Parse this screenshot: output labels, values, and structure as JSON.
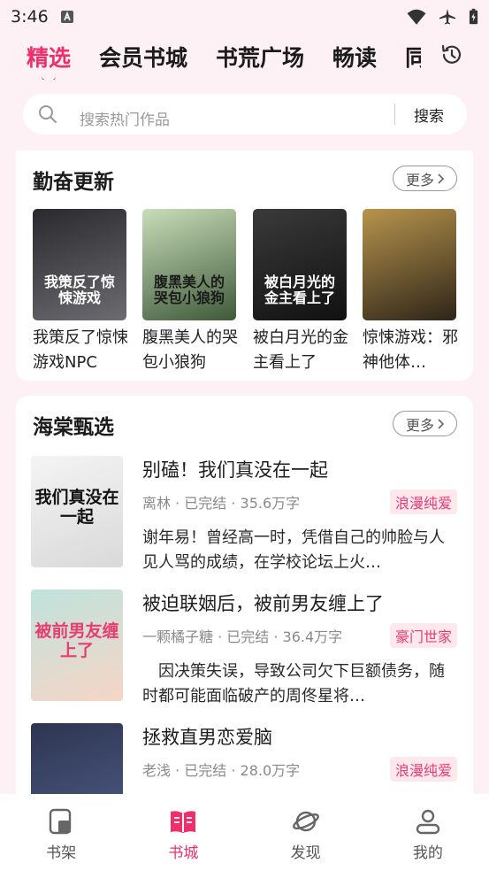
{
  "status_bar": {
    "time": "3:46",
    "icons": [
      "notification-a-icon",
      "wifi-icon",
      "airplane-icon",
      "battery-charging-icon"
    ]
  },
  "top_tabs": [
    {
      "label": "精选",
      "active": true
    },
    {
      "label": "会员书城",
      "active": false
    },
    {
      "label": "书荒广场",
      "active": false
    },
    {
      "label": "畅读",
      "active": false
    },
    {
      "label": "同",
      "active": false
    }
  ],
  "history_icon": "history-clock-icon",
  "search": {
    "placeholder": "搜索热门作品",
    "button": "搜索"
  },
  "section_updates": {
    "title": "勤奋更新",
    "more": "更多",
    "books": [
      {
        "title": "我策反了惊悚游戏NPC",
        "cover_text": "我策反了惊悚游戏",
        "cover_colors": [
          "#2a2a2e",
          "#6b6b70"
        ],
        "cover_text_color": "#ffffff"
      },
      {
        "title": "腹黑美人的哭包小狼狗",
        "cover_text": "腹黑美人的哭包小狼狗",
        "cover_colors": [
          "#c9ddb9",
          "#3f5a3a"
        ],
        "cover_text_color": "#1a1a1a"
      },
      {
        "title": "被白月光的金主看上了",
        "cover_text": "被白月光的金主看上了",
        "cover_colors": [
          "#3a3a3a",
          "#111111"
        ],
        "cover_text_color": "#ffffff"
      },
      {
        "title": "惊悚游戏：邪神他体…",
        "cover_text": "",
        "cover_colors": [
          "#b8944d",
          "#2e2518"
        ],
        "cover_text_color": "#ffffff"
      }
    ]
  },
  "section_picks": {
    "title": "海棠甄选",
    "more": "更多",
    "books": [
      {
        "title": "别磕！我们真没在一起",
        "meta": "离林 · 已完结 · 35.6万字",
        "tag": "浪漫纯爱",
        "desc": "谢年易！曾经高一时，凭借自己的帅脸与人见人骂的成绩，在学校论坛上火…",
        "cover_text": "我们真没在一起",
        "cover_colors": [
          "#f4f4f4",
          "#d9d9d9"
        ],
        "cover_text_color": "#111111"
      },
      {
        "title": "被迫联姻后，被前男友缠上了",
        "meta": "一颗橘子糖 · 已完结 · 36.4万字",
        "tag": "豪门世家",
        "desc": "　因决策失误，导致公司欠下巨额债务，随时都可能面临破产的周佟星将…",
        "cover_text": "被前男友缠上了",
        "cover_colors": [
          "#bfe3dc",
          "#f6d5c6"
        ],
        "cover_text_color": "#e83d72"
      },
      {
        "title": "拯救直男恋爱脑",
        "meta": "老浅 · 已完结 · 28.0万字",
        "tag": "浪漫纯爱",
        "desc": "",
        "cover_text": "",
        "cover_colors": [
          "#2d3550",
          "#4d5b86"
        ],
        "cover_text_color": "#ffffff"
      }
    ]
  },
  "bottom_nav": [
    {
      "label": "书架",
      "icon": "bookshelf-icon",
      "active": false
    },
    {
      "label": "书城",
      "icon": "open-book-icon",
      "active": true
    },
    {
      "label": "发现",
      "icon": "planet-icon",
      "active": false
    },
    {
      "label": "我的",
      "icon": "person-icon",
      "active": false
    }
  ],
  "colors": {
    "accent": "#ee2f6b",
    "background": "#fdf1f5",
    "tag_bg": "#fde8ee",
    "tag_text": "#e83d72"
  }
}
